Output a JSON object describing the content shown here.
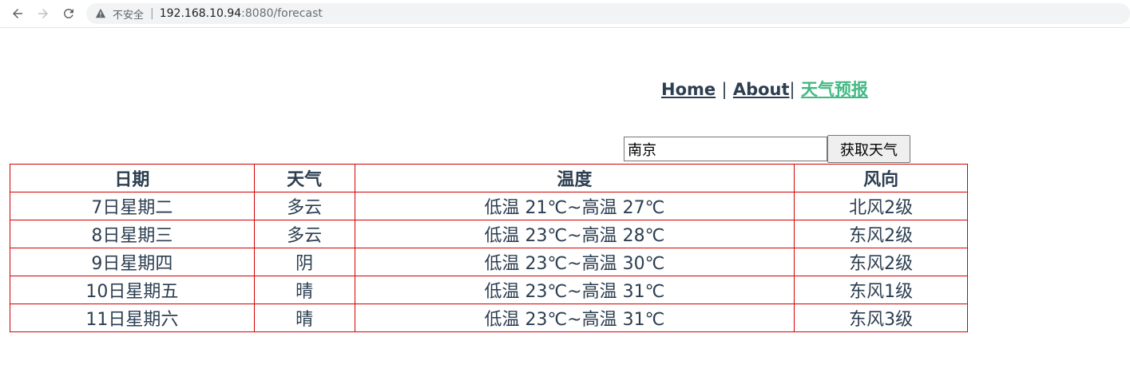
{
  "browser": {
    "security_label": "不安全",
    "url_host": "192.168.10.94",
    "url_rest": ":8080/forecast"
  },
  "nav": {
    "home": "Home",
    "about": "About",
    "forecast": "天气预报",
    "divider": "|",
    "active_color": "#42b983"
  },
  "search": {
    "value": "南京",
    "button_label": "获取天气"
  },
  "table": {
    "headers": [
      "日期",
      "天气",
      "温度",
      "风向"
    ],
    "rows": [
      [
        "7日星期二",
        "多云",
        "低温 21℃~高温 27℃",
        "北风2级"
      ],
      [
        "8日星期三",
        "多云",
        "低温 23℃~高温 28℃",
        "东风2级"
      ],
      [
        "9日星期四",
        "阴",
        "低温 23℃~高温 30℃",
        "东风2级"
      ],
      [
        "10日星期五",
        "晴",
        "低温 23℃~高温 31℃",
        "东风1级"
      ],
      [
        "11日星期六",
        "晴",
        "低温 23℃~高温 31℃",
        "东风3级"
      ]
    ],
    "border_color": "#d40000"
  }
}
